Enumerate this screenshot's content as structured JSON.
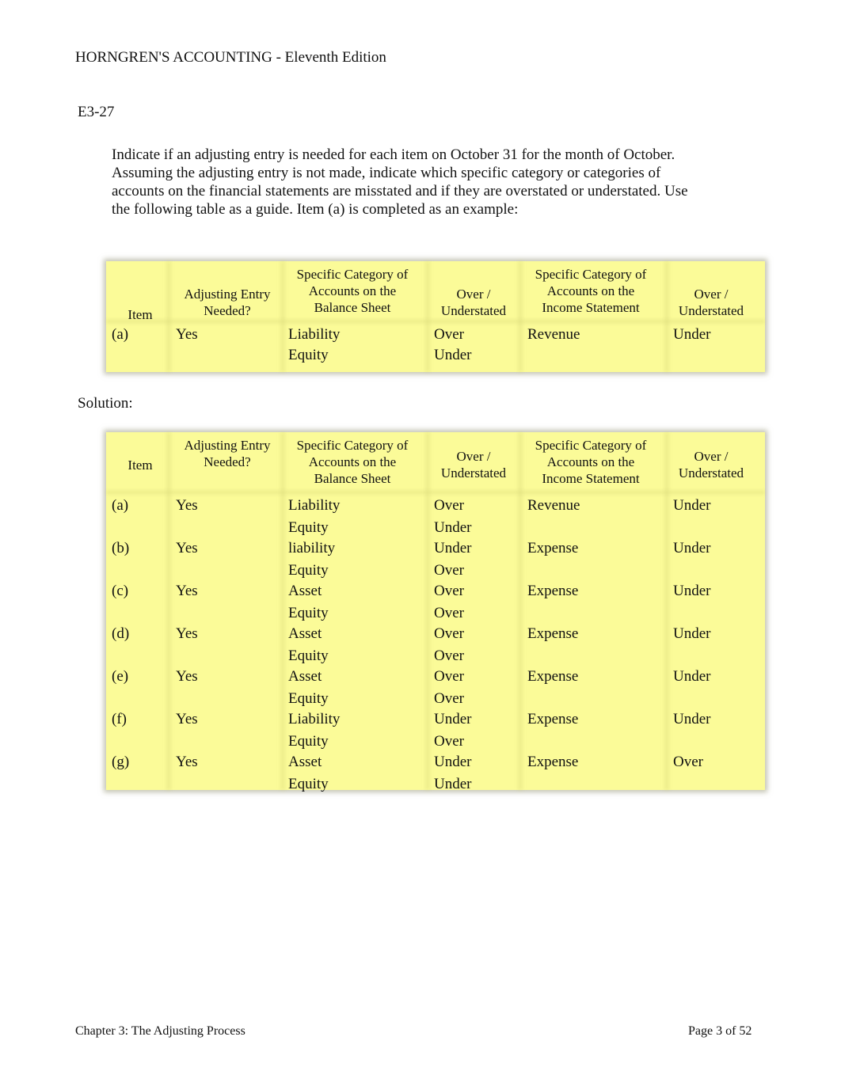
{
  "header": {
    "title": "HORNGREN'S ACCOUNTING - Eleventh Edition"
  },
  "exercise": {
    "id": "E3-27",
    "instructions": "Indicate if an adjusting entry is needed for each item on October 31 for the month of October. Assuming the adjusting entry is not made, indicate which specific category or categories of accounts on the financial statements are misstated and if they are overstated or understated. Use the following table as a guide. Item (a) is completed as an example:"
  },
  "example_table": {
    "headers": [
      "Item",
      "Adjusting Entry Needed?",
      "Specific Category of Accounts on the Balance Sheet",
      "Over / Understated",
      "Specific Category of Accounts on the Income Statement",
      "Over / Understated"
    ],
    "rows": [
      {
        "item": "(a)",
        "needed": "Yes",
        "bs": "Liability",
        "bs_ou": "Over",
        "is": "Revenue",
        "is_ou": "Under"
      },
      {
        "item": "",
        "needed": "",
        "bs": "Equity",
        "bs_ou": "Under",
        "is": "",
        "is_ou": ""
      }
    ]
  },
  "solution_label": "Solution:",
  "solution_table": {
    "headers": [
      "Item",
      "Adjusting Entry Needed?",
      "Specific Category of Accounts on the Balance Sheet",
      "Over / Understated",
      "Specific Category of Accounts on the Income Statement",
      "Over / Understated"
    ],
    "rows": [
      {
        "item": "(a)",
        "needed": "Yes",
        "bs": "Liability",
        "bs_ou": "Over",
        "is": "Revenue",
        "is_ou": "Under"
      },
      {
        "item": "",
        "needed": "",
        "bs": "Equity",
        "bs_ou": "Under",
        "is": "",
        "is_ou": ""
      },
      {
        "item": "(b)",
        "needed": "Yes",
        "bs": "liability",
        "bs_ou": "Under",
        "is": "Expense",
        "is_ou": "Under"
      },
      {
        "item": "",
        "needed": "",
        "bs": "Equity",
        "bs_ou": "Over",
        "is": "",
        "is_ou": ""
      },
      {
        "item": "(c)",
        "needed": "Yes",
        "bs": "Asset",
        "bs_ou": "Over",
        "is": "Expense",
        "is_ou": "Under"
      },
      {
        "item": "",
        "needed": "",
        "bs": "Equity",
        "bs_ou": "Over",
        "is": "",
        "is_ou": ""
      },
      {
        "item": "(d)",
        "needed": "Yes",
        "bs": "Asset",
        "bs_ou": "Over",
        "is": "Expense",
        "is_ou": "Under"
      },
      {
        "item": "",
        "needed": "",
        "bs": "Equity",
        "bs_ou": "Over",
        "is": "",
        "is_ou": ""
      },
      {
        "item": "(e)",
        "needed": "Yes",
        "bs": "Asset",
        "bs_ou": "Over",
        "is": "Expense",
        "is_ou": "Under"
      },
      {
        "item": "",
        "needed": "",
        "bs": "Equity",
        "bs_ou": "Over",
        "is": "",
        "is_ou": ""
      },
      {
        "item": "(f)",
        "needed": "Yes",
        "bs": "Liability",
        "bs_ou": "Under",
        "is": "Expense",
        "is_ou": "Under"
      },
      {
        "item": "",
        "needed": "",
        "bs": "Equity",
        "bs_ou": "Over",
        "is": "",
        "is_ou": ""
      },
      {
        "item": "(g)",
        "needed": "Yes",
        "bs": "Asset",
        "bs_ou": "Under",
        "is": "Expense",
        "is_ou": "Over"
      },
      {
        "item": "",
        "needed": "",
        "bs": "Equity",
        "bs_ou": "Under",
        "is": "",
        "is_ou": ""
      }
    ]
  },
  "footer": {
    "chapter": "Chapter 3: The Adjusting Process",
    "page": "Page 3 of 52"
  },
  "colors": {
    "table_fill": "#fbfb98"
  }
}
